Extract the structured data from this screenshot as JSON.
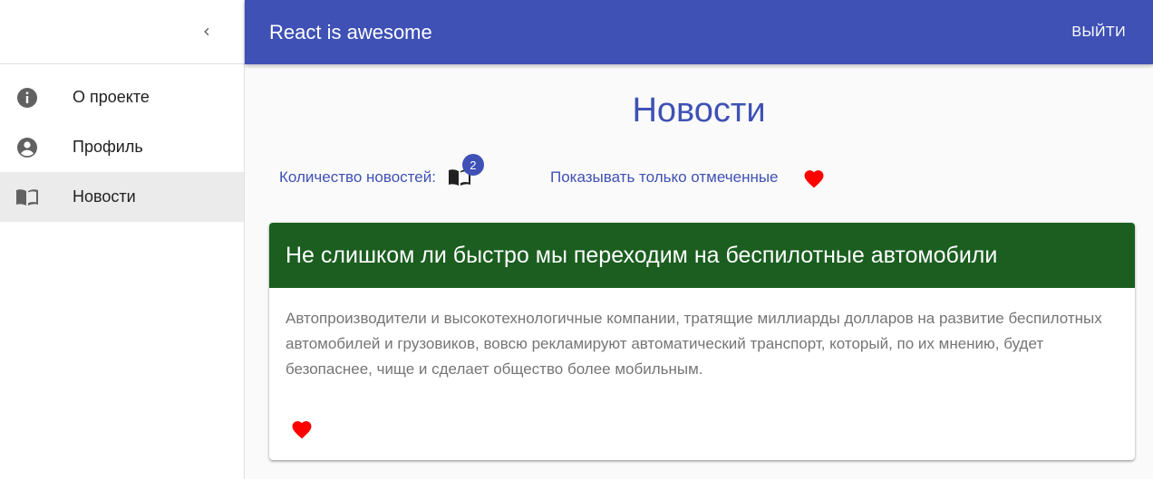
{
  "app": {
    "title": "React is awesome",
    "logout_label": "ВЫЙТИ"
  },
  "sidebar": {
    "items": [
      {
        "label": "О проекте",
        "icon": "info-icon",
        "active": false
      },
      {
        "label": "Профиль",
        "icon": "account-circle-icon",
        "active": false
      },
      {
        "label": "Новости",
        "icon": "book-icon",
        "active": true
      }
    ]
  },
  "main": {
    "title": "Новости",
    "counter_label": "Количество новостей:",
    "news_count": "2",
    "filter_label": "Показывать только отмеченные"
  },
  "news": [
    {
      "title": "Не слишком ли быстро мы переходим на беспилотные автомобили",
      "body": "Автопроизводители и высокотехнологичные компании, тратящие миллиарды долларов на развитие беспилотных автомобилей и грузовиков, вовсю рекламируют автоматический транспорт, который, по их мнению, будет безопаснее, чище и сделает общество более мобильным.",
      "liked": true
    }
  ],
  "colors": {
    "primary": "#3f51b5",
    "card_header": "#1b5e20",
    "heart": "#ff0000",
    "active_nav": "#ebebeb"
  }
}
